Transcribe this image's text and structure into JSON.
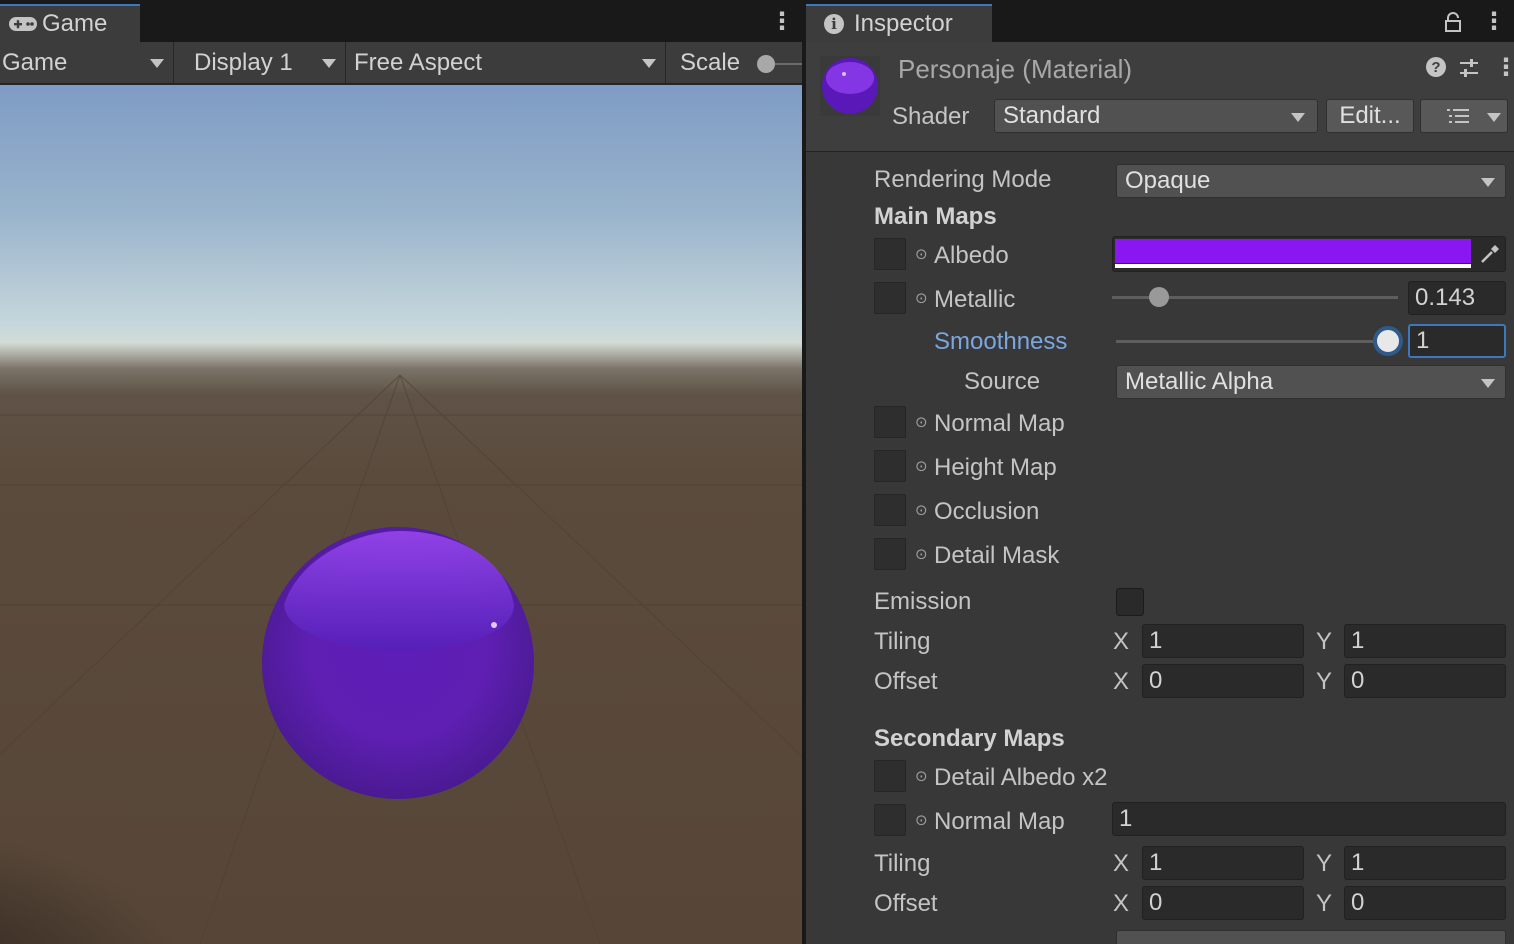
{
  "game": {
    "tab_label": "Game",
    "toolbar": {
      "mode": "Game",
      "display": "Display 1",
      "aspect": "Free Aspect",
      "scale_label": "Scale"
    }
  },
  "inspector": {
    "tab_label": "Inspector",
    "material_name": "Personaje (Material)",
    "shader_label": "Shader",
    "shader_value": "Standard",
    "edit_label": "Edit...",
    "rendering_mode_label": "Rendering Mode",
    "rendering_mode_value": "Opaque",
    "main_maps_header": "Main Maps",
    "albedo_label": "Albedo",
    "albedo_color": "#8a16f2",
    "metallic_label": "Metallic",
    "metallic_value": "0.143",
    "smoothness_label": "Smoothness",
    "smoothness_value": "1",
    "source_label": "Source",
    "source_value": "Metallic Alpha",
    "normal_map_label": "Normal Map",
    "height_map_label": "Height Map",
    "occlusion_label": "Occlusion",
    "detail_mask_label": "Detail Mask",
    "emission_label": "Emission",
    "tiling_label": "Tiling",
    "offset_label": "Offset",
    "x_label": "X",
    "y_label": "Y",
    "main_tiling_x": "1",
    "main_tiling_y": "1",
    "main_offset_x": "0",
    "main_offset_y": "0",
    "secondary_maps_header": "Secondary Maps",
    "detail_albedo_label": "Detail Albedo x2",
    "secondary_normal_label": "Normal Map",
    "secondary_normal_value": "1",
    "sec_tiling_x": "1",
    "sec_tiling_y": "1",
    "sec_offset_x": "0",
    "sec_offset_y": "0"
  },
  "colors": {
    "accent": "#3a79bb",
    "smoothness_label": "#7ba6e0",
    "sphere": "#6a22c8"
  },
  "icons": [
    "gamepad-icon",
    "info-icon",
    "lock-icon",
    "kebab-icon",
    "help-icon",
    "settings-icon",
    "eyedropper-icon",
    "list-icon"
  ]
}
